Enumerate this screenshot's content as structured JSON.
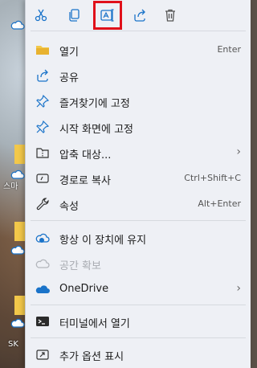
{
  "desktop": {
    "label_1": "스마",
    "label_2": "SK"
  },
  "toolbar": {
    "cut": "cut",
    "copy": "copy",
    "rename": "rename",
    "share": "share",
    "delete": "delete"
  },
  "menu": {
    "items": [
      {
        "label": "열기",
        "shortcut": "Enter"
      },
      {
        "label": "공유"
      },
      {
        "label": "즐겨찾기에 고정"
      },
      {
        "label": "시작 화면에 고정"
      },
      {
        "label": "압축 대상...",
        "submenu": "›"
      },
      {
        "label": "경로로 복사",
        "shortcut": "Ctrl+Shift+C"
      },
      {
        "label": "속성",
        "shortcut": "Alt+Enter"
      },
      {
        "label": "항상 이 장치에 유지"
      },
      {
        "label": "공간 확보"
      },
      {
        "label": "OneDrive",
        "submenu": "›"
      },
      {
        "label": "터미널에서 열기"
      },
      {
        "label": "추가 옵션 표시"
      }
    ]
  },
  "colors": {
    "accent_blue": "#1a73c9",
    "selection_outline": "#e0101a"
  }
}
